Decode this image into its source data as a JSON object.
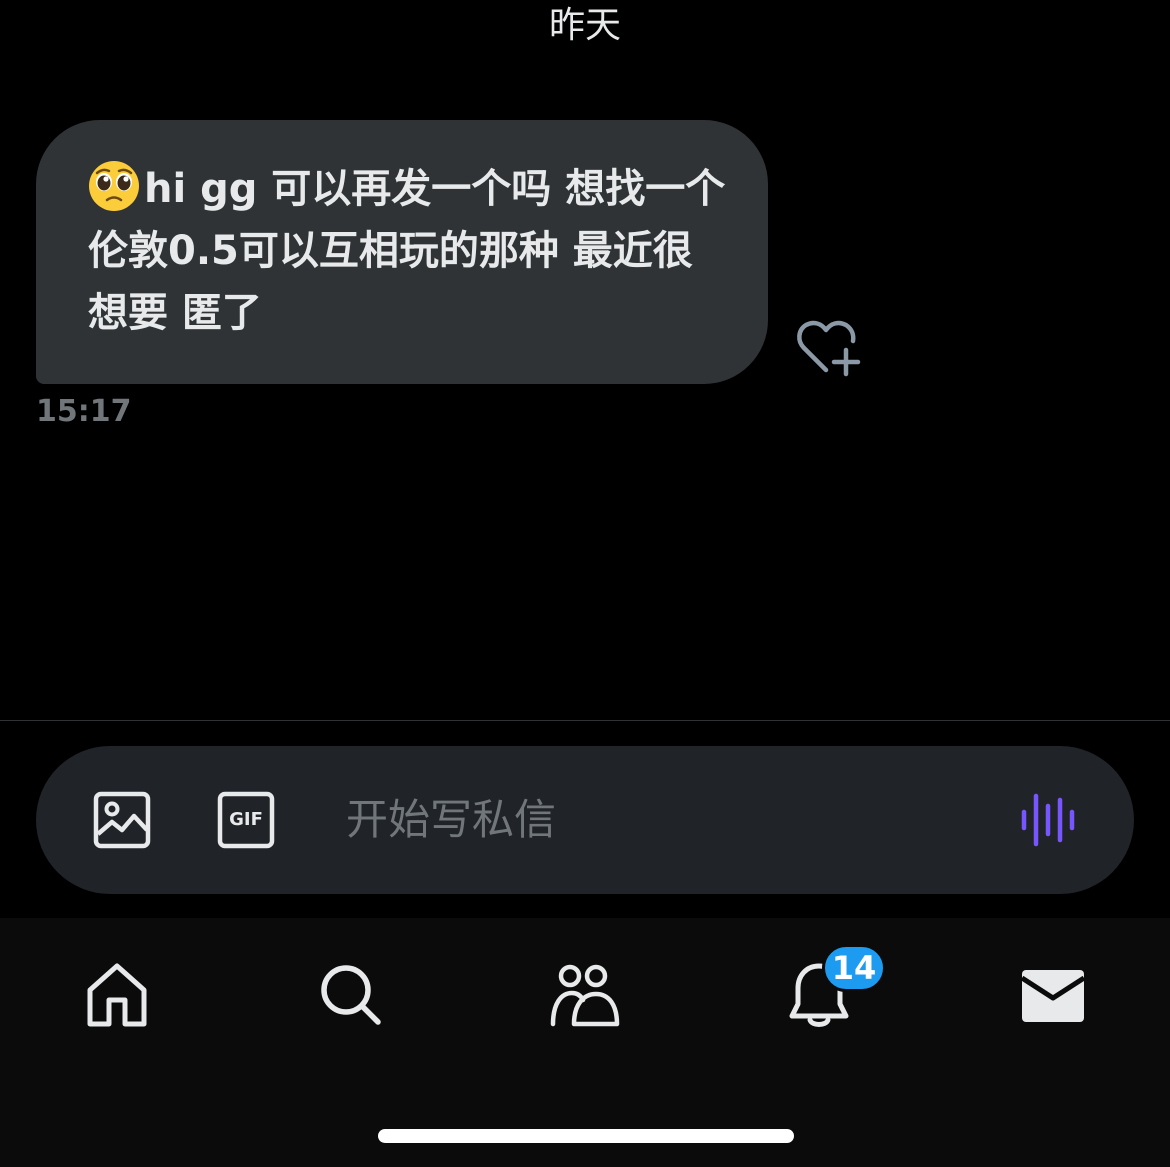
{
  "conversation": {
    "day_label": "昨天",
    "messages": [
      {
        "text": "hi gg 可以再发一个吗 想找一个伦敦0.5可以互相玩的那种 最近很想要 匿了",
        "emoji": "pleading-face-emoji",
        "time": "15:17"
      }
    ]
  },
  "composer": {
    "placeholder": "开始写私信",
    "gif_label": "GIF",
    "icons": [
      "image-icon",
      "gif-icon",
      "voice-message-icon"
    ],
    "accent_color": "#7856ff"
  },
  "tabbar": {
    "items": [
      {
        "name": "home",
        "icon": "home-icon"
      },
      {
        "name": "search",
        "icon": "search-icon"
      },
      {
        "name": "communities",
        "icon": "people-icon"
      },
      {
        "name": "notifications",
        "icon": "bell-icon",
        "badge": "14"
      },
      {
        "name": "messages",
        "icon": "envelope-icon"
      }
    ],
    "badge_color": "#1d9bf0"
  }
}
